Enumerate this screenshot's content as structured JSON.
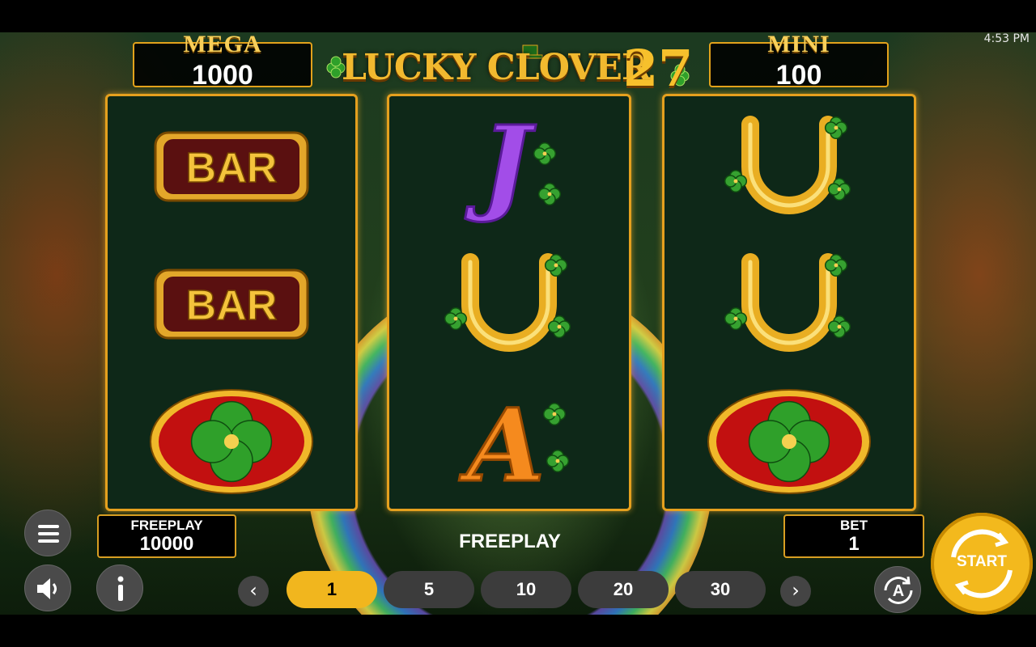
{
  "status_bar": {
    "time": "4:53 PM"
  },
  "jackpots": {
    "mega": {
      "label": "MEGA",
      "value": "1000"
    },
    "mini": {
      "label": "MINI",
      "value": "100"
    }
  },
  "logo": {
    "text": "LUCKY CLOVER",
    "number": "27"
  },
  "reels": [
    [
      "bar-symbol",
      "bar-symbol",
      "clover-symbol"
    ],
    [
      "jack-symbol",
      "horseshoe-symbol",
      "ace-symbol"
    ],
    [
      "horseshoe-symbol",
      "horseshoe-symbol",
      "clover-symbol"
    ]
  ],
  "symbol_text": {
    "bar": "BAR",
    "jack": "J",
    "ace": "A"
  },
  "freeplay": {
    "label": "FREEPLAY",
    "value": "10000"
  },
  "mode_label": "FREEPLAY",
  "bet": {
    "label": "BET",
    "value": "1"
  },
  "bet_options": [
    "1",
    "5",
    "10",
    "20",
    "30"
  ],
  "selected_bet": "1",
  "nav": {
    "prev": "‹",
    "next": "›"
  },
  "autoplay_label": "A",
  "start_label": "START",
  "colors": {
    "gold": "#f1b61e",
    "reel_frame": "#e5a01e",
    "reel_bg": "#0e2818",
    "button_grey": "#3c3c3c"
  }
}
